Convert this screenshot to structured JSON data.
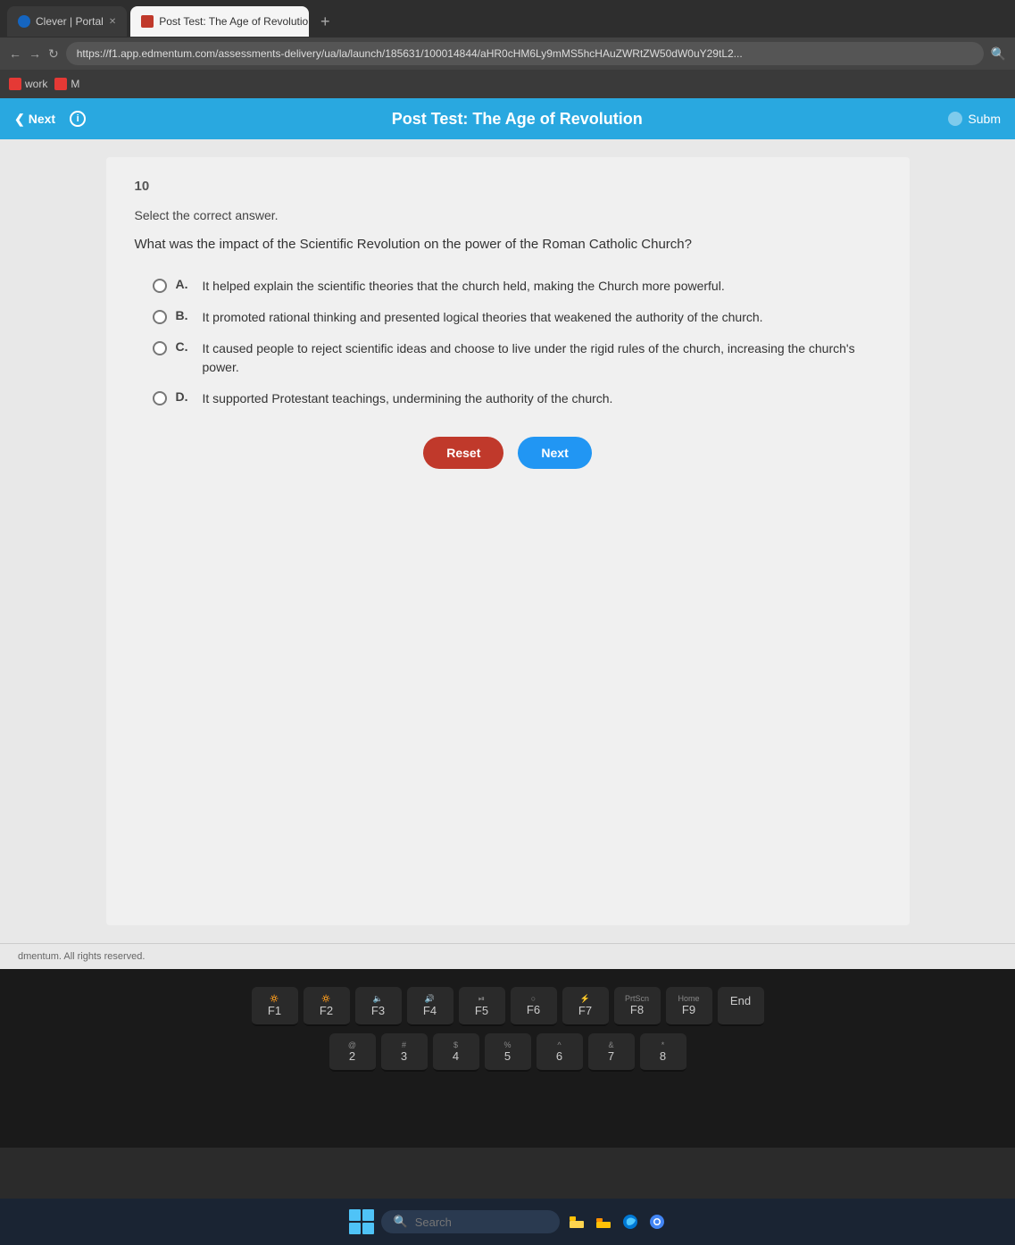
{
  "browser": {
    "tabs": [
      {
        "id": "clever",
        "label": "Clever | Portal",
        "active": false,
        "favicon": "clever"
      },
      {
        "id": "edmentum",
        "label": "Post Test: The Age of Revolution",
        "active": true,
        "favicon": "edmentum"
      }
    ],
    "new_tab_label": "+",
    "address_bar": {
      "url": "https://f1.app.edmentum.com/assessments-delivery/ua/la/launch/185631/100014844/aHR0cHM6Ly9mMS5hcHAuZWRtZW50dW0uY29tL2..."
    },
    "bookmarks": [
      {
        "label": "work",
        "color": "#e53935"
      },
      {
        "label": "M",
        "color": "#e53935"
      }
    ]
  },
  "app": {
    "header": {
      "next_label": "Next",
      "info_icon": "i",
      "title": "Post Test: The Age of Revolution",
      "submit_label": "Subm"
    }
  },
  "question": {
    "number": "10",
    "instruction": "Select the correct answer.",
    "text": "What was the impact of the Scientific Revolution on the power of the Roman Catholic Church?",
    "options": [
      {
        "letter": "A.",
        "text": "It helped explain the scientific theories that the church held, making the Church more powerful."
      },
      {
        "letter": "B.",
        "text": "It promoted rational thinking and presented logical theories that weakened the authority of the church."
      },
      {
        "letter": "C.",
        "text": "It caused people to reject scientific ideas and choose to live under the rigid rules of the church, increasing the church's power."
      },
      {
        "letter": "D.",
        "text": "It supported Protestant teachings, undermining the authority of the church."
      }
    ],
    "reset_label": "Reset",
    "next_label": "Next"
  },
  "footer": {
    "copyright": "dmentum. All rights reserved."
  },
  "taskbar": {
    "search_placeholder": "Search",
    "icons": [
      "windows",
      "file-manager",
      "edge",
      "chrome"
    ]
  }
}
